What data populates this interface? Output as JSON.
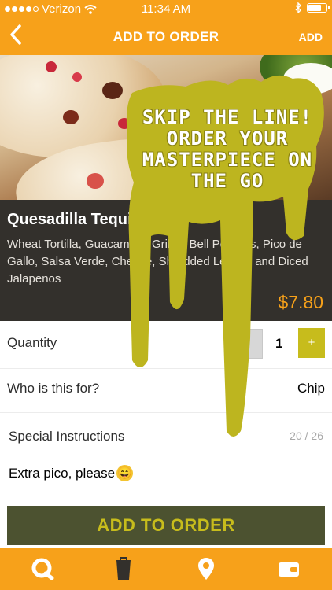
{
  "status_bar": {
    "carrier": "Verizon",
    "time": "11:34 AM",
    "battery_level": 0.75
  },
  "nav": {
    "back_icon": "chevron-left-icon",
    "title": "ADD TO ORDER",
    "add_label": "ADD"
  },
  "item": {
    "name": "Quesadilla Tequila Lime",
    "description": "Wheat Tortilla, Guacamole, Grilled Bell Peppers, Pico de Gallo, Salsa Verde, Cheese, Shredded Lettuce and Diced Jalapenos",
    "price": "$7.80"
  },
  "form": {
    "quantity_label": "Quantity",
    "quantity_minus": "-",
    "quantity_value": "1",
    "quantity_plus": "+",
    "who_label": "Who is this for?",
    "who_value": "Chip",
    "special_label": "Special Instructions",
    "special_counter": "20 / 26",
    "special_value": "Extra pico, please",
    "special_emoji": "😄"
  },
  "cta": {
    "label": "ADD TO ORDER"
  },
  "promo": {
    "text": "SKIP THE LINE! ORDER YOUR MASTERPIECE ON THE GO"
  },
  "tabs": [
    {
      "icon": "qdoba-logo-icon"
    },
    {
      "icon": "bag-icon"
    },
    {
      "icon": "location-pin-icon"
    },
    {
      "icon": "wallet-icon"
    }
  ],
  "colors": {
    "brand_orange": "#f7a11a",
    "accent_olive": "#c7bc1c",
    "dark": "#33302c",
    "button_dark": "#4c5230"
  }
}
